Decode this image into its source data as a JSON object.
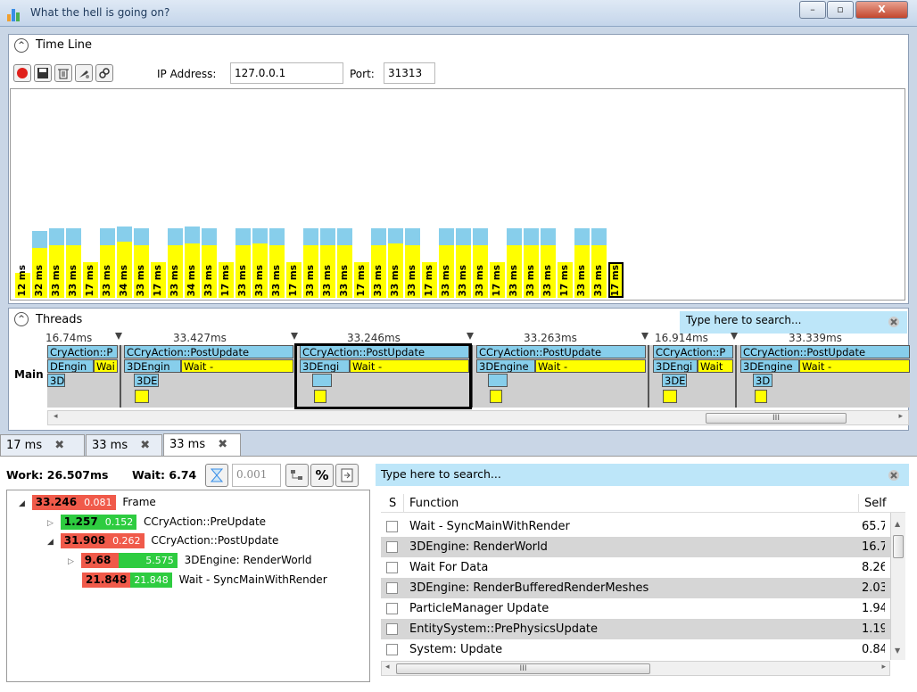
{
  "window": {
    "title": "What the hell is going on?",
    "minimize": "–",
    "maximize": "▫",
    "close": "X"
  },
  "timeline": {
    "title": "Time Line",
    "collapse_glyph": "^",
    "ip_label": "IP Address:",
    "ip_value": "127.0.0.1",
    "port_label": "Port:",
    "port_value": "31313",
    "frames": [
      {
        "label": "12 ms",
        "total": 12,
        "work": 12
      },
      {
        "label": "32 ms",
        "total": 32,
        "work": 24
      },
      {
        "label": "33 ms",
        "total": 33,
        "work": 25
      },
      {
        "label": "33 ms",
        "total": 33,
        "work": 25
      },
      {
        "label": "17 ms",
        "total": 17,
        "work": 17
      },
      {
        "label": "33 ms",
        "total": 33,
        "work": 25
      },
      {
        "label": "34 ms",
        "total": 34,
        "work": 27
      },
      {
        "label": "33 ms",
        "total": 33,
        "work": 25
      },
      {
        "label": "17 ms",
        "total": 17,
        "work": 17
      },
      {
        "label": "33 ms",
        "total": 33,
        "work": 25
      },
      {
        "label": "34 ms",
        "total": 34,
        "work": 26
      },
      {
        "label": "33 ms",
        "total": 33,
        "work": 25
      },
      {
        "label": "17 ms",
        "total": 17,
        "work": 17
      },
      {
        "label": "33 ms",
        "total": 33,
        "work": 25
      },
      {
        "label": "33 ms",
        "total": 33,
        "work": 26
      },
      {
        "label": "33 ms",
        "total": 33,
        "work": 25
      },
      {
        "label": "17 ms",
        "total": 17,
        "work": 17
      },
      {
        "label": "33 ms",
        "total": 33,
        "work": 25
      },
      {
        "label": "33 ms",
        "total": 33,
        "work": 25
      },
      {
        "label": "33 ms",
        "total": 33,
        "work": 25
      },
      {
        "label": "17 ms",
        "total": 17,
        "work": 17
      },
      {
        "label": "33 ms",
        "total": 33,
        "work": 25
      },
      {
        "label": "33 ms",
        "total": 33,
        "work": 26
      },
      {
        "label": "33 ms",
        "total": 33,
        "work": 25
      },
      {
        "label": "17 ms",
        "total": 17,
        "work": 17
      },
      {
        "label": "33 ms",
        "total": 33,
        "work": 25
      },
      {
        "label": "33 ms",
        "total": 33,
        "work": 25
      },
      {
        "label": "33 ms",
        "total": 33,
        "work": 25
      },
      {
        "label": "17 ms",
        "total": 17,
        "work": 17
      },
      {
        "label": "33 ms",
        "total": 33,
        "work": 25
      },
      {
        "label": "33 ms",
        "total": 33,
        "work": 25
      },
      {
        "label": "33 ms",
        "total": 33,
        "work": 25
      },
      {
        "label": "17 ms",
        "total": 17,
        "work": 17
      },
      {
        "label": "33 ms",
        "total": 33,
        "work": 25
      },
      {
        "label": "33 ms",
        "total": 33,
        "work": 25
      },
      {
        "label": "17 ms",
        "total": 17,
        "work": 17
      }
    ],
    "selected_frame": 35,
    "colors": {
      "frame_total": "#87ceeb",
      "frame_work": "#ffff00"
    }
  },
  "threads": {
    "title": "Threads",
    "collapse_glyph": "^",
    "search_placeholder": "Type here to search...",
    "thread_name": "Main",
    "frame_times": [
      "16.74ms",
      "33.427ms",
      "33.246ms",
      "33.263ms",
      "16.914ms",
      "33.339ms"
    ],
    "blocks": {
      "c1": "CryAction::P",
      "e1": "DEngin",
      "w1": "Wai",
      "d1": "3D",
      "c2": "CCryAction::PostUpdate",
      "e2": "3DEngin",
      "w2": "Wait -",
      "d2": "3DE",
      "c3": "CCryAction::PostUpdate",
      "e3": "3DEngi",
      "w3": "Wait -",
      "c4": "CCryAction::PostUpdate",
      "e4": "3DEngine",
      "w4": "Wait -",
      "c5": "CCryAction::P",
      "e5": "3DEngi",
      "w5": "Wait",
      "d5": "3DE",
      "c6": "CCryAction::PostUpdate",
      "e6": "3DEngine",
      "w6": "Wait -",
      "d6": "3D"
    },
    "scroll_thumb": "III"
  },
  "tabs": [
    {
      "label": "17 ms",
      "close": "✖"
    },
    {
      "label": "33 ms",
      "close": "✖"
    },
    {
      "label": "33 ms",
      "close": "✖"
    }
  ],
  "summary": {
    "work": "Work: 26.507ms",
    "wait": "Wait: 6.74",
    "threshold": "0.001",
    "pct": "%"
  },
  "tree": [
    {
      "total": "33.246",
      "self": "0.081",
      "name": "Frame",
      "arrow": "◢"
    },
    {
      "total": "1.257",
      "self": "0.152",
      "name": "CCryAction::PreUpdate",
      "arrow": "▷"
    },
    {
      "total": "31.908",
      "self": "0.262",
      "name": "CCryAction::PostUpdate",
      "arrow": "◢"
    },
    {
      "total": "9.68",
      "self": "5.575",
      "name": "3DEngine: RenderWorld",
      "arrow": "▷"
    },
    {
      "total": "21.848",
      "self": "21.848",
      "name": "Wait - SyncMainWithRender",
      "arrow": ""
    }
  ],
  "functions": {
    "search_placeholder": "Type here to search...",
    "col_s": "S",
    "col_function": "Function",
    "col_self": "Self",
    "rows": [
      {
        "name": "Wait - SyncMainWithRender",
        "self": "65.7"
      },
      {
        "name": "3DEngine: RenderWorld",
        "self": "16.7"
      },
      {
        "name": "Wait For Data",
        "self": "8.26"
      },
      {
        "name": "3DEngine: RenderBufferedRenderMeshes",
        "self": "2.03"
      },
      {
        "name": "ParticleManager Update",
        "self": "1.94"
      },
      {
        "name": "EntitySystem::PrePhysicsUpdate",
        "self": "1.19"
      },
      {
        "name": "System: Update",
        "self": "0.84"
      }
    ],
    "scroll_thumb": "III"
  }
}
